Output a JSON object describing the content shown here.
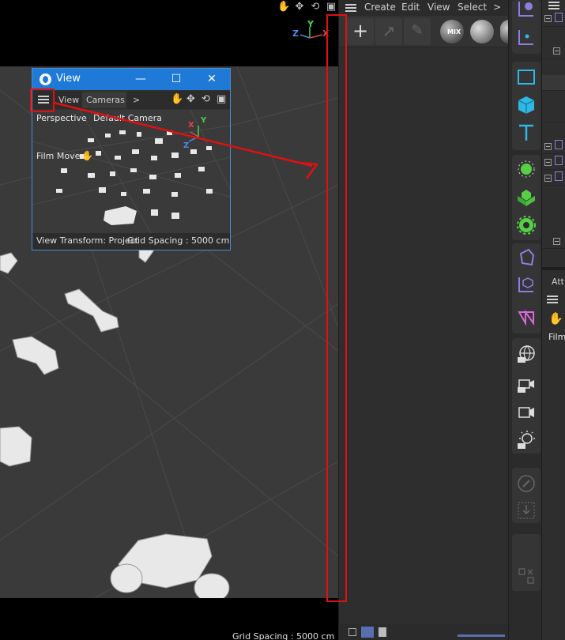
{
  "viewport": {
    "grid_spacing": "Grid Spacing : 5000 cm",
    "axis_labels": {
      "x": "X",
      "y": "Y",
      "z": "Z"
    },
    "nav_icons": [
      "hand-icon",
      "move-arrows-icon",
      "rotate-icon",
      "maximize-view-icon"
    ]
  },
  "view_window": {
    "title": "View",
    "menu": {
      "view": "View",
      "cameras": "Cameras",
      "more": ">"
    },
    "projection": "Perspective",
    "camera": "Default Camera",
    "film_move": "Film Move",
    "status_left": "View Transform: Project",
    "status_right": "Grid Spacing : 5000 cm",
    "axis_labels": {
      "x": "X",
      "y": "Y",
      "z": "Z"
    }
  },
  "material_panel": {
    "menu": {
      "create": "Create",
      "edit": "Edit",
      "view": "View",
      "select": "Select",
      "more": ">"
    },
    "mix_label": "MIX"
  },
  "attributes": {
    "tab": "Attr",
    "film_label": "Film"
  },
  "colors": {
    "accent_blue": "#1e7ad6",
    "annotation_red": "#e01010",
    "icon_purple": "#8b7fe0",
    "icon_cyan": "#2fb8e6",
    "icon_green": "#56d045"
  }
}
